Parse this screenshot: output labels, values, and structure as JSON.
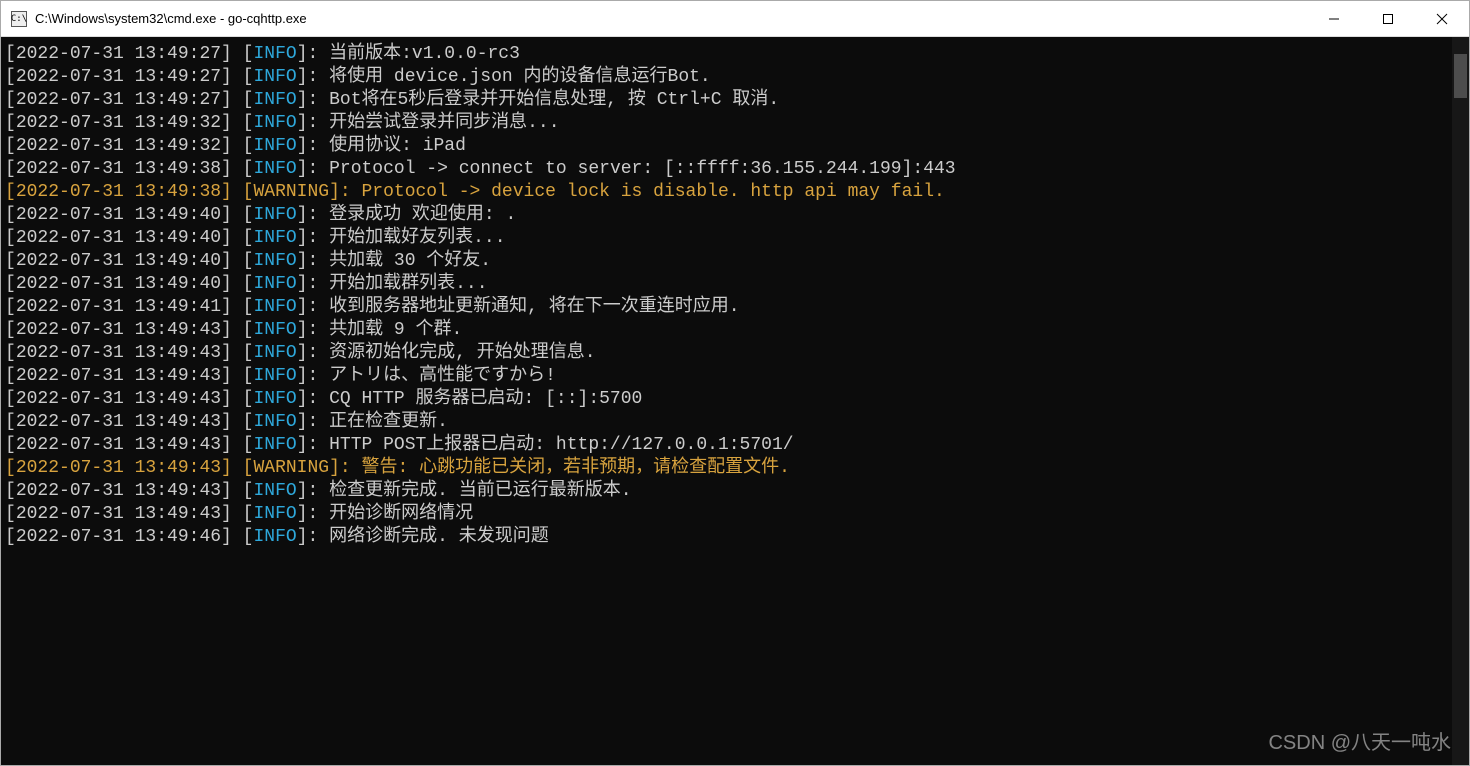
{
  "titlebar": {
    "icon_label": "C:\\",
    "title": "C:\\Windows\\system32\\cmd.exe - go-cqhttp.exe"
  },
  "window_controls": {
    "minimize": "minimize",
    "maximize": "maximize",
    "close": "close"
  },
  "log_lines": [
    {
      "ts": "2022-07-31 13:49:27",
      "level": "INFO",
      "msg": "当前版本:v1.0.0-rc3"
    },
    {
      "ts": "2022-07-31 13:49:27",
      "level": "INFO",
      "msg": "将使用 device.json 内的设备信息运行Bot."
    },
    {
      "ts": "2022-07-31 13:49:27",
      "level": "INFO",
      "msg": "Bot将在5秒后登录并开始信息处理, 按 Ctrl+C 取消."
    },
    {
      "ts": "2022-07-31 13:49:32",
      "level": "INFO",
      "msg": "开始尝试登录并同步消息..."
    },
    {
      "ts": "2022-07-31 13:49:32",
      "level": "INFO",
      "msg": "使用协议: iPad"
    },
    {
      "ts": "2022-07-31 13:49:38",
      "level": "INFO",
      "msg": "Protocol -> connect to server: [::ffff:36.155.244.199]:443"
    },
    {
      "ts": "2022-07-31 13:49:38",
      "level": "WARNING",
      "msg": "Protocol -> device lock is disable. http api may fail."
    },
    {
      "ts": "2022-07-31 13:49:40",
      "level": "INFO",
      "msg": "登录成功 欢迎使用: ."
    },
    {
      "ts": "2022-07-31 13:49:40",
      "level": "INFO",
      "msg": "开始加载好友列表..."
    },
    {
      "ts": "2022-07-31 13:49:40",
      "level": "INFO",
      "msg": "共加载 30 个好友."
    },
    {
      "ts": "2022-07-31 13:49:40",
      "level": "INFO",
      "msg": "开始加载群列表..."
    },
    {
      "ts": "2022-07-31 13:49:41",
      "level": "INFO",
      "msg": "收到服务器地址更新通知, 将在下一次重连时应用."
    },
    {
      "ts": "2022-07-31 13:49:43",
      "level": "INFO",
      "msg": "共加载 9 个群."
    },
    {
      "ts": "2022-07-31 13:49:43",
      "level": "INFO",
      "msg": "资源初始化完成, 开始处理信息."
    },
    {
      "ts": "2022-07-31 13:49:43",
      "level": "INFO",
      "msg": "アトリは、高性能ですから!"
    },
    {
      "ts": "2022-07-31 13:49:43",
      "level": "INFO",
      "msg": "CQ HTTP 服务器已启动: [::]:5700"
    },
    {
      "ts": "2022-07-31 13:49:43",
      "level": "INFO",
      "msg": "正在检查更新."
    },
    {
      "ts": "2022-07-31 13:49:43",
      "level": "INFO",
      "msg": "HTTP POST上报器已启动: http://127.0.0.1:5701/"
    },
    {
      "ts": "2022-07-31 13:49:43",
      "level": "WARNING",
      "msg": "警告: 心跳功能已关闭，若非预期，请检查配置文件."
    },
    {
      "ts": "2022-07-31 13:49:43",
      "level": "INFO",
      "msg": "检查更新完成. 当前已运行最新版本."
    },
    {
      "ts": "2022-07-31 13:49:43",
      "level": "INFO",
      "msg": "开始诊断网络情况"
    },
    {
      "ts": "2022-07-31 13:49:46",
      "level": "INFO",
      "msg": "网络诊断完成. 未发现问题"
    }
  ],
  "watermark": "CSDN @八天一吨水"
}
